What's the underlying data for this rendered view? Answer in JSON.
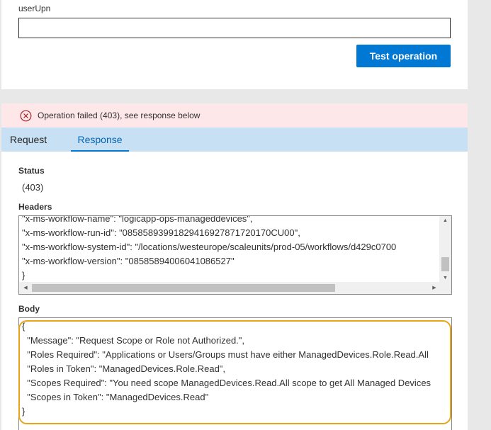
{
  "top": {
    "field_label": "userUpn",
    "input_value": "",
    "test_button_label": "Test operation"
  },
  "error": {
    "message": "Operation failed (403), see response below",
    "color": "#a4262c"
  },
  "tabs": [
    {
      "label": "Request",
      "active": false
    },
    {
      "label": "Response",
      "active": true
    }
  ],
  "status": {
    "label": "Status",
    "value": "(403)"
  },
  "headers": {
    "label": "Headers",
    "lines": [
      "\"x-ms-workflow-name\": \"logicapp-ops-manageddevices\",",
      "\"x-ms-workflow-run-id\": \"08585893991829416927871720170CU00\",",
      "\"x-ms-workflow-system-id\": \"/locations/westeurope/scaleunits/prod-05/workflows/d429c0700",
      "\"x-ms-workflow-version\": \"08585894006041086527\"",
      "}"
    ]
  },
  "body": {
    "label": "Body",
    "lines": [
      "{",
      "  \"Message\": \"Request Scope or Role not Authorized.\",",
      "  \"Roles Required\": \"Applications or Users/Groups must have either ManagedDevices.Role.Read.All",
      "  \"Roles in Token\": \"ManagedDevices.Role.Read\",",
      "  \"Scopes Required\": \"You need scope ManagedDevices.Read.All scope to get All Managed Devices",
      "  \"Scopes in Token\": \"ManagedDevices.Read\"",
      "}"
    ]
  },
  "colors": {
    "accent": "#0078d4",
    "error_bg": "#fde7e9",
    "tab_bg": "#c7e0f4",
    "highlight": "#e8a317"
  }
}
